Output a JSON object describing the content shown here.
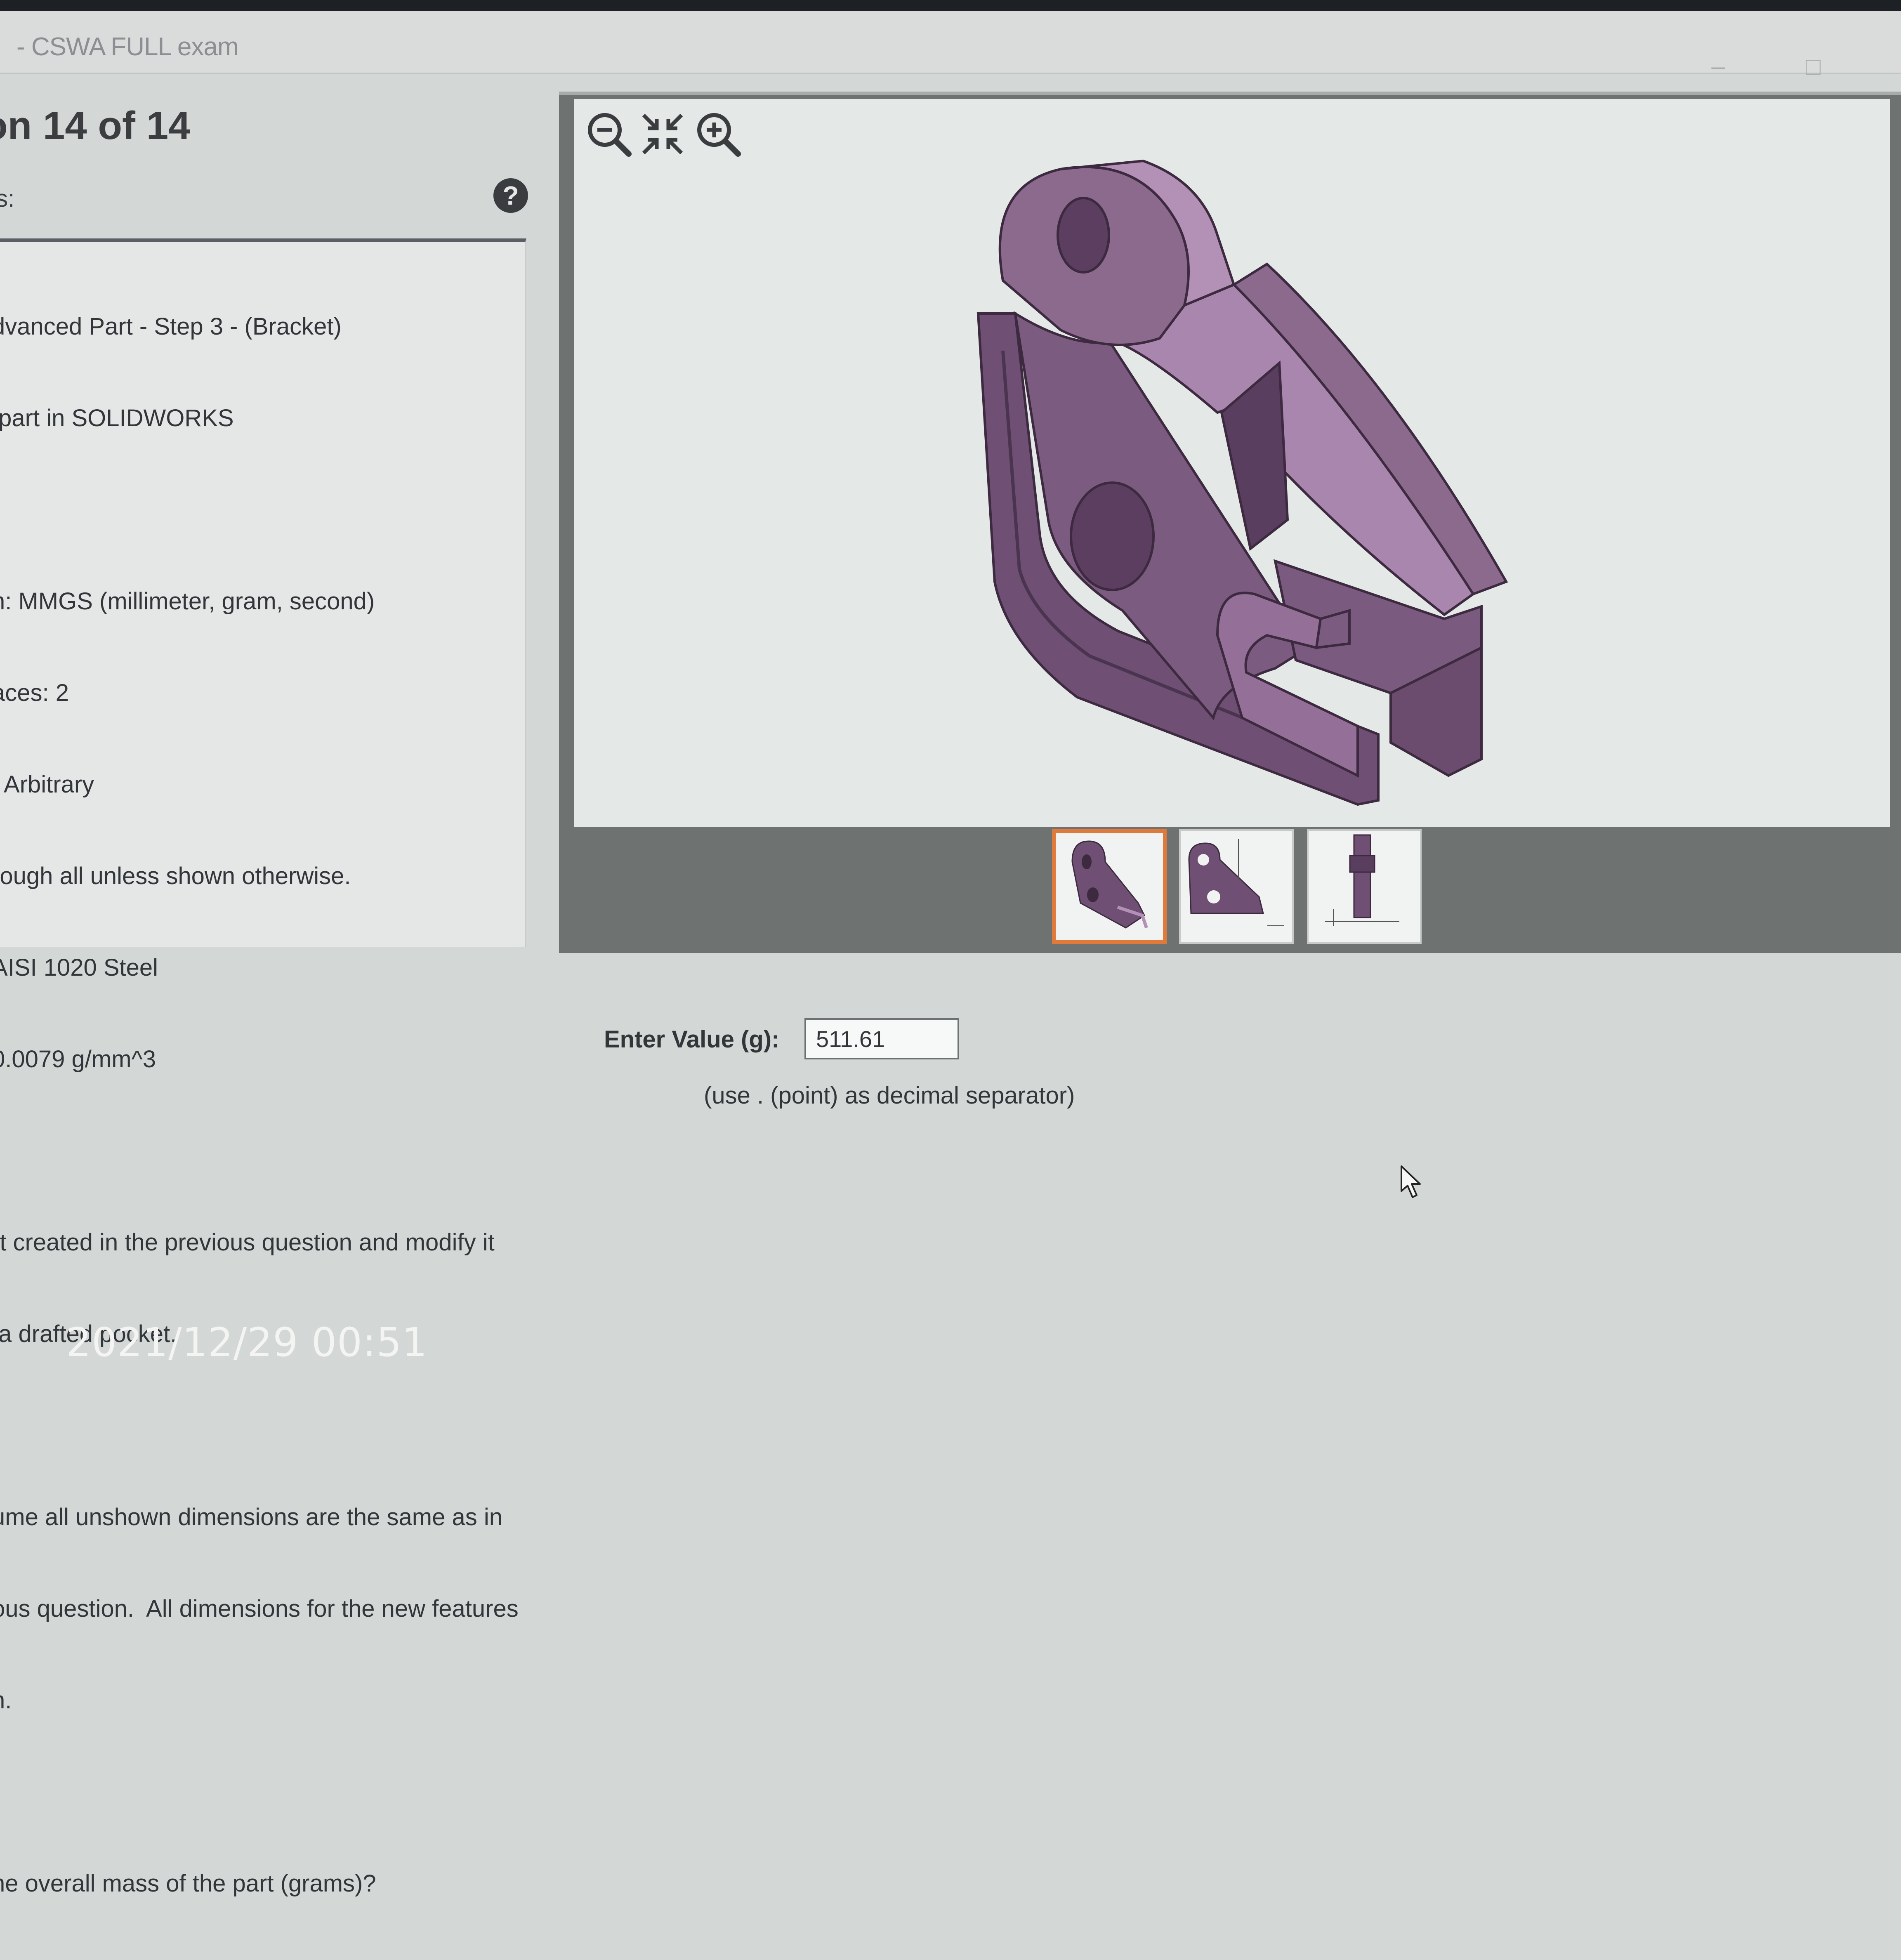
{
  "window": {
    "title": "- CSWA FULL exam",
    "minimize_glyph": "–",
    "maximize_glyph": "□"
  },
  "question": {
    "heading": "on 14 of 14",
    "panel_label": "s:",
    "help_icon": "question-mark-icon",
    "lines": [
      "dvanced Part - Step 3 - (Bracket)",
      " part in SOLIDWORKS",
      "",
      "n: MMGS (millimeter, gram, second)",
      "aces: 2",
      ": Arbitrary",
      "rough all unless shown otherwise.",
      "AISI 1020 Steel",
      "0.0079 g/mm^3",
      "",
      "rt created in the previous question and modify it",
      " a drafted pocket.",
      "",
      "ume all unshown dimensions are the same as in",
      "ous question.  All dimensions for the new features",
      "n.",
      "",
      "he overall mass of the part (grams)?"
    ]
  },
  "viewer": {
    "toolbar": [
      "zoom-out-icon",
      "fit-to-view-icon",
      "zoom-in-icon"
    ],
    "thumbnails": [
      {
        "name": "isometric-view-thumbnail",
        "selected": true
      },
      {
        "name": "front-view-thumbnail",
        "selected": false
      },
      {
        "name": "side-view-thumbnail",
        "selected": false
      }
    ],
    "part_color": "#8c6a8e",
    "selection_color": "#e07a3a"
  },
  "answer": {
    "label": "Enter Value (g):",
    "value": "511.61",
    "hint": "(use . (point) as decimal separator)"
  },
  "photo_timestamp": "2021/12/29 00:51"
}
